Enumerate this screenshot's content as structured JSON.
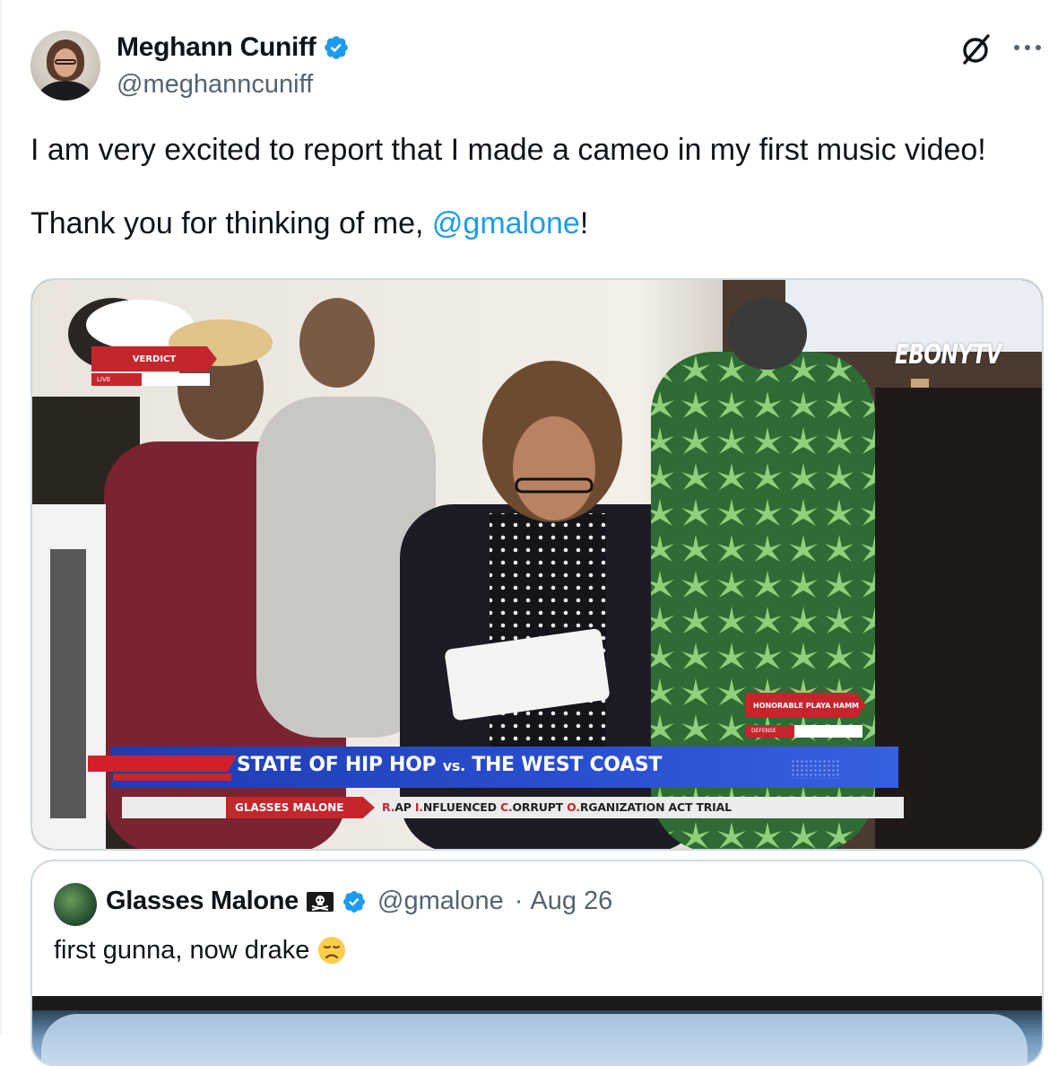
{
  "author": {
    "display_name": "Meghann Cuniff",
    "handle": "@meghanncuniff",
    "verified": true
  },
  "tweet": {
    "line1": "I am very excited to report that I made a cameo in my first music video!",
    "line2_prefix": "Thank you for thinking of me, ",
    "mention": "@gmalone",
    "line2_suffix": "!"
  },
  "icons": {
    "grok": "grok-icon",
    "more": "more-icon",
    "verified": "verified-badge-icon"
  },
  "colors": {
    "link": "#1d9bf0",
    "verified": "#1d9bf0",
    "secondary_text": "#536471",
    "border": "#cfd9de"
  },
  "media_overlay": {
    "verdict_label": "VERDICT",
    "live_label": "LIVE",
    "watermark": "EBONYTV",
    "playa_label": "HONORABLE PLAYA HAMM",
    "defense_label": "DEFENSE",
    "banner_main": "STATE OF HIP HOP",
    "banner_vs": "vs.",
    "banner_tail": "THE WEST COAST",
    "ticker_name": "GLASSES MALONE",
    "ticker_r": "R.",
    "ticker_r_rest": "AP ",
    "ticker_i": "I.",
    "ticker_i_rest": "NFLUENCED ",
    "ticker_c": "C.",
    "ticker_c_rest": "ORRUPT ",
    "ticker_o": "O.",
    "ticker_o_rest": "RGANIZATION ACT TRIAL"
  },
  "quoted": {
    "display_name": "Glasses Malone",
    "handle": "@gmalone",
    "separator": "·",
    "date": "Aug 26",
    "text": "first gunna, now drake",
    "emoji": "disappointed-face"
  }
}
